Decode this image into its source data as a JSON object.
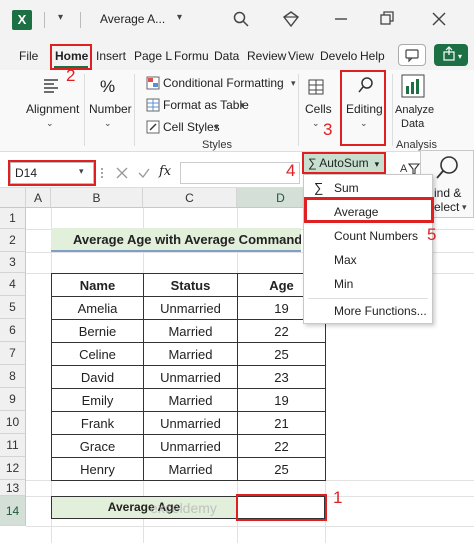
{
  "window": {
    "doc_title": "Average A...",
    "app_logo": "X"
  },
  "tabs": [
    {
      "label": "File"
    },
    {
      "label": "Home"
    },
    {
      "label": "Insert"
    },
    {
      "label": "Page L"
    },
    {
      "label": "Formu"
    },
    {
      "label": "Data"
    },
    {
      "label": "Review"
    },
    {
      "label": "View"
    },
    {
      "label": "Develo"
    },
    {
      "label": "Help"
    }
  ],
  "ribbon": {
    "alignment": "Alignment",
    "number": "Number",
    "conditional_formatting": "Conditional Formatting",
    "format_as_table": "Format as Table",
    "cell_styles": "Cell Styles",
    "styles_group": "Styles",
    "cells": "Cells",
    "editing": "Editing",
    "analyze_data_line1": "Analyze",
    "analyze_data_line2": "Data",
    "analysis_group": "Analysis",
    "find_select_line1": "ind &",
    "find_select_line2": "elect"
  },
  "formula_bar": {
    "name_box": "D14",
    "fx": "fx"
  },
  "columns": [
    "A",
    "B",
    "C",
    "D",
    "E"
  ],
  "rows": [
    "1",
    "2",
    "3",
    "4",
    "5",
    "6",
    "7",
    "8",
    "9",
    "10",
    "11",
    "12",
    "13",
    "14"
  ],
  "sheet": {
    "title": "Average Age with Average Command",
    "headers": [
      "Name",
      "Status",
      "Age"
    ],
    "records": [
      [
        "Amelia",
        "Unmarried",
        "19"
      ],
      [
        "Bernie",
        "Married",
        "22"
      ],
      [
        "Celine",
        "Married",
        "25"
      ],
      [
        "David",
        "Unmarried",
        "23"
      ],
      [
        "Emily",
        "Married",
        "19"
      ],
      [
        "Frank",
        "Unmarried",
        "21"
      ],
      [
        "Grace",
        "Unmarried",
        "22"
      ],
      [
        "Henry",
        "Married",
        "25"
      ]
    ],
    "avg_label": "Average Age"
  },
  "autosum_menu": {
    "button_label": "AutoSum",
    "items": [
      "Sum",
      "Average",
      "Count Numbers",
      "Max",
      "Min",
      "More Functions..."
    ]
  },
  "annotations": [
    "1",
    "2",
    "3",
    "4",
    "5"
  ],
  "watermark": "exceldemy",
  "colors": {
    "excel_green": "#1d7044",
    "highlight_red": "#e02020",
    "title_fill": "#e2efda"
  }
}
